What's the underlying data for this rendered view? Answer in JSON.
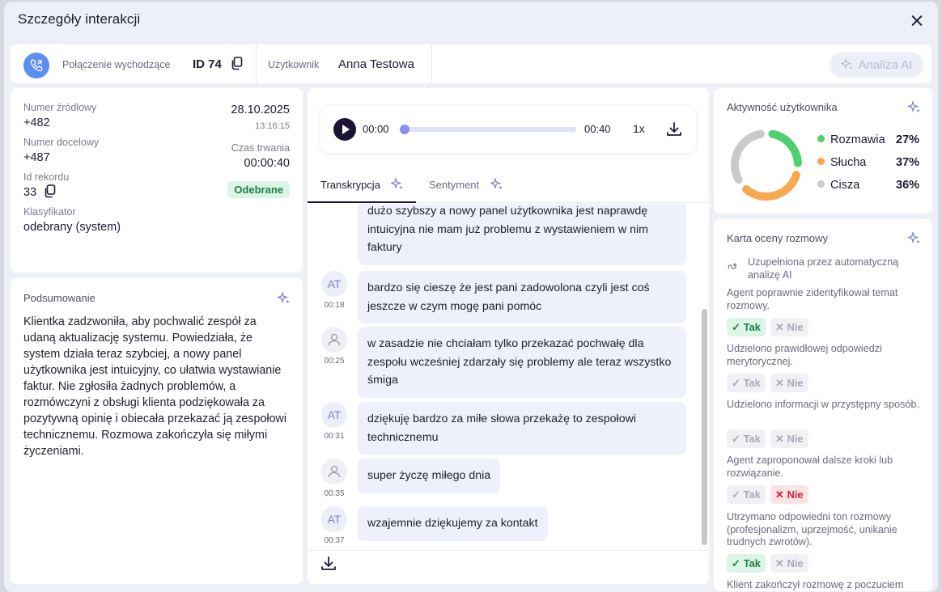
{
  "modal": {
    "title": "Szczegóły interakcji"
  },
  "header": {
    "call_type": "Połączenie wychodzące",
    "id_label": "ID 74",
    "user_label": "Użytkownik",
    "user_name": "Anna Testowa",
    "ai_button": "Analiza AI"
  },
  "details": {
    "source_label": "Numer źródłowy",
    "source_value": "+482",
    "date": "28.10.2025",
    "time": "13:16:15",
    "target_label": "Numer docelowy",
    "target_value": "+487",
    "duration_label": "Czas trwania",
    "duration_value": "00:00:40",
    "record_label": "Id rekordu",
    "record_value": "33",
    "status_badge": "Odebrane",
    "classifier_label": "Klasyfikator",
    "classifier_value": "odebrany (system)"
  },
  "summary": {
    "title": "Podsumowanie",
    "text": "Klientka zadzwoniła, aby pochwalić zespół za udaną aktualizację systemu. Powiedziała, że system działa teraz szybciej, a nowy panel użytkownika jest intuicyjny, co ułatwia wystawianie faktur. Nie zgłosiła żadnych problemów, a rozmówczyni z obsługi klienta podziękowała za pozytywną opinię i obiecała przekazać ją zespołowi technicznemu. Rozmowa zakończyła się miłymi życzeniami."
  },
  "player": {
    "current": "00:00",
    "total": "00:40",
    "speed": "1x",
    "progress": 0
  },
  "tabs": [
    {
      "label": "Transkrypcja",
      "active": true
    },
    {
      "label": "Sentyment",
      "active": false
    }
  ],
  "transcript": [
    {
      "who": "user",
      "initials": "",
      "time": "",
      "text": "dużo szybszy a nowy panel użytkownika jest naprawdę intuicyjna nie mam już problemu z wystawieniem w nim faktury"
    },
    {
      "who": "agent",
      "initials": "AT",
      "time": "00:18",
      "text": "bardzo się cieszę że jest pani zadowolona czyli jest coś jeszcze w czym mogę pani pomóc"
    },
    {
      "who": "user",
      "initials": "",
      "time": "00:25",
      "text": "w zasadzie nie chciałam tylko przekazać pochwałę dla zespołu wcześniej zdarzały się problemy ale teraz wszystko śmiga"
    },
    {
      "who": "agent",
      "initials": "AT",
      "time": "00:31",
      "text": "dziękuję bardzo za miłe słowa przekażę to zespołowi technicznemu"
    },
    {
      "who": "user",
      "initials": "",
      "time": "00:35",
      "text": "super życzę miłego dnia"
    },
    {
      "who": "agent",
      "initials": "AT",
      "time": "00:37",
      "text": "wzajemnie dziękujemy za kontakt"
    }
  ],
  "activity": {
    "title": "Aktywność użytkownika",
    "items": [
      {
        "label": "Rozmawia",
        "value": "27%",
        "pct": 27,
        "color": "#4ed06f"
      },
      {
        "label": "Słucha",
        "value": "37%",
        "pct": 37,
        "color": "#f7a94f"
      },
      {
        "label": "Cisza",
        "value": "36%",
        "pct": 36,
        "color": "#c9cac9"
      }
    ]
  },
  "scorecard": {
    "title": "Karta oceny rozmowy",
    "auto_note": "Uzupełniona przez automatyczną analizę AI",
    "yes_label": "Tak",
    "no_label": "Nie",
    "criteria": [
      {
        "text": "Agent poprawnie zidentyfikował temat rozmowy.",
        "answer": "yes"
      },
      {
        "text": "Udzielono prawidłowej odpowiedzi merytorycznej.",
        "answer": "none"
      },
      {
        "text": "Udzielono informacji w przystępny sposób.",
        "answer": "none"
      },
      {
        "text": "Agent zaproponował dalsze kroki lub rozwiązanie.",
        "answer": "no"
      },
      {
        "text": "Utrzymano odpowiedni ton rozmowy (profesjonalizm, uprzejmość, unikanie trudnych zwrotów).",
        "answer": "yes"
      },
      {
        "text": "Klient zakończył rozmowę z poczuciem",
        "answer": "none"
      }
    ]
  }
}
